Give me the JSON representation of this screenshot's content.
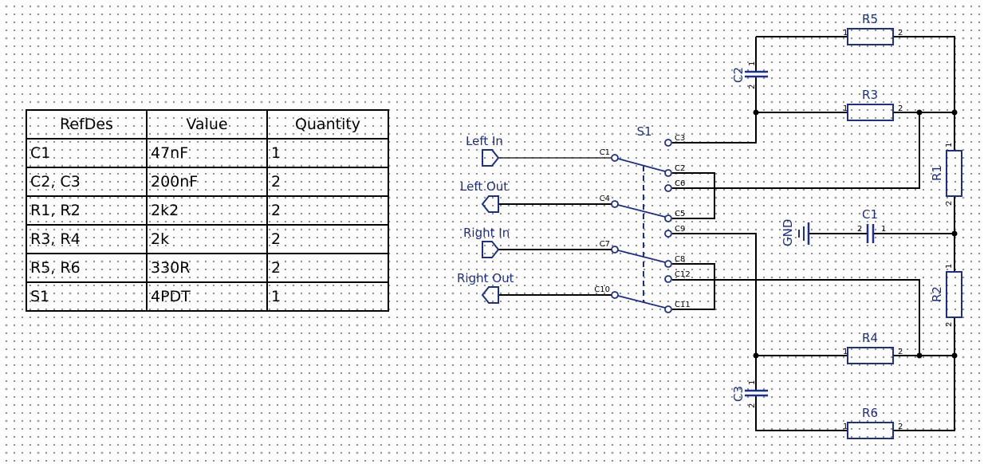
{
  "bom_table": {
    "headers": [
      "RefDes",
      "Value",
      "Quantity"
    ],
    "rows": [
      [
        "C1",
        "47nF",
        "1"
      ],
      [
        "C2, C3",
        "200nF",
        "2"
      ],
      [
        "R1, R2",
        "2k2",
        "2"
      ],
      [
        "R3, R4",
        "2k",
        "2"
      ],
      [
        "R5, R6",
        "330R",
        "2"
      ],
      [
        "S1",
        "4PDT",
        "1"
      ]
    ]
  },
  "schematic": {
    "resistors": [
      {
        "ref": "R5",
        "pins": [
          "1",
          "2"
        ]
      },
      {
        "ref": "R3",
        "pins": [
          "1",
          "2"
        ]
      },
      {
        "ref": "R4",
        "pins": [
          "1",
          "2"
        ]
      },
      {
        "ref": "R6",
        "pins": [
          "1",
          "2"
        ]
      },
      {
        "ref": "R1",
        "pins": [
          "1",
          "2"
        ]
      },
      {
        "ref": "R2",
        "pins": [
          "1",
          "2"
        ]
      }
    ],
    "capacitors": [
      {
        "ref": "C2",
        "pins": [
          "1",
          "2"
        ]
      },
      {
        "ref": "C3",
        "pins": [
          "1",
          "2"
        ]
      },
      {
        "ref": "C1",
        "pins": [
          "2",
          "1"
        ]
      }
    ],
    "switch": {
      "ref": "S1",
      "contacts": [
        "C1",
        "C2",
        "C3",
        "C4",
        "C5",
        "C6",
        "C7",
        "C8",
        "C9",
        "C10",
        "C11",
        "C12"
      ]
    },
    "ports": [
      {
        "label": "Left In",
        "direction": "input"
      },
      {
        "label": "Left Out",
        "direction": "output"
      },
      {
        "label": "Right In",
        "direction": "input"
      },
      {
        "label": "Right Out",
        "direction": "output"
      }
    ],
    "ground": "GND"
  },
  "colors": {
    "component": "#1b2f8e",
    "wire": "#000000",
    "grid_dot": "#6a6a6a"
  }
}
